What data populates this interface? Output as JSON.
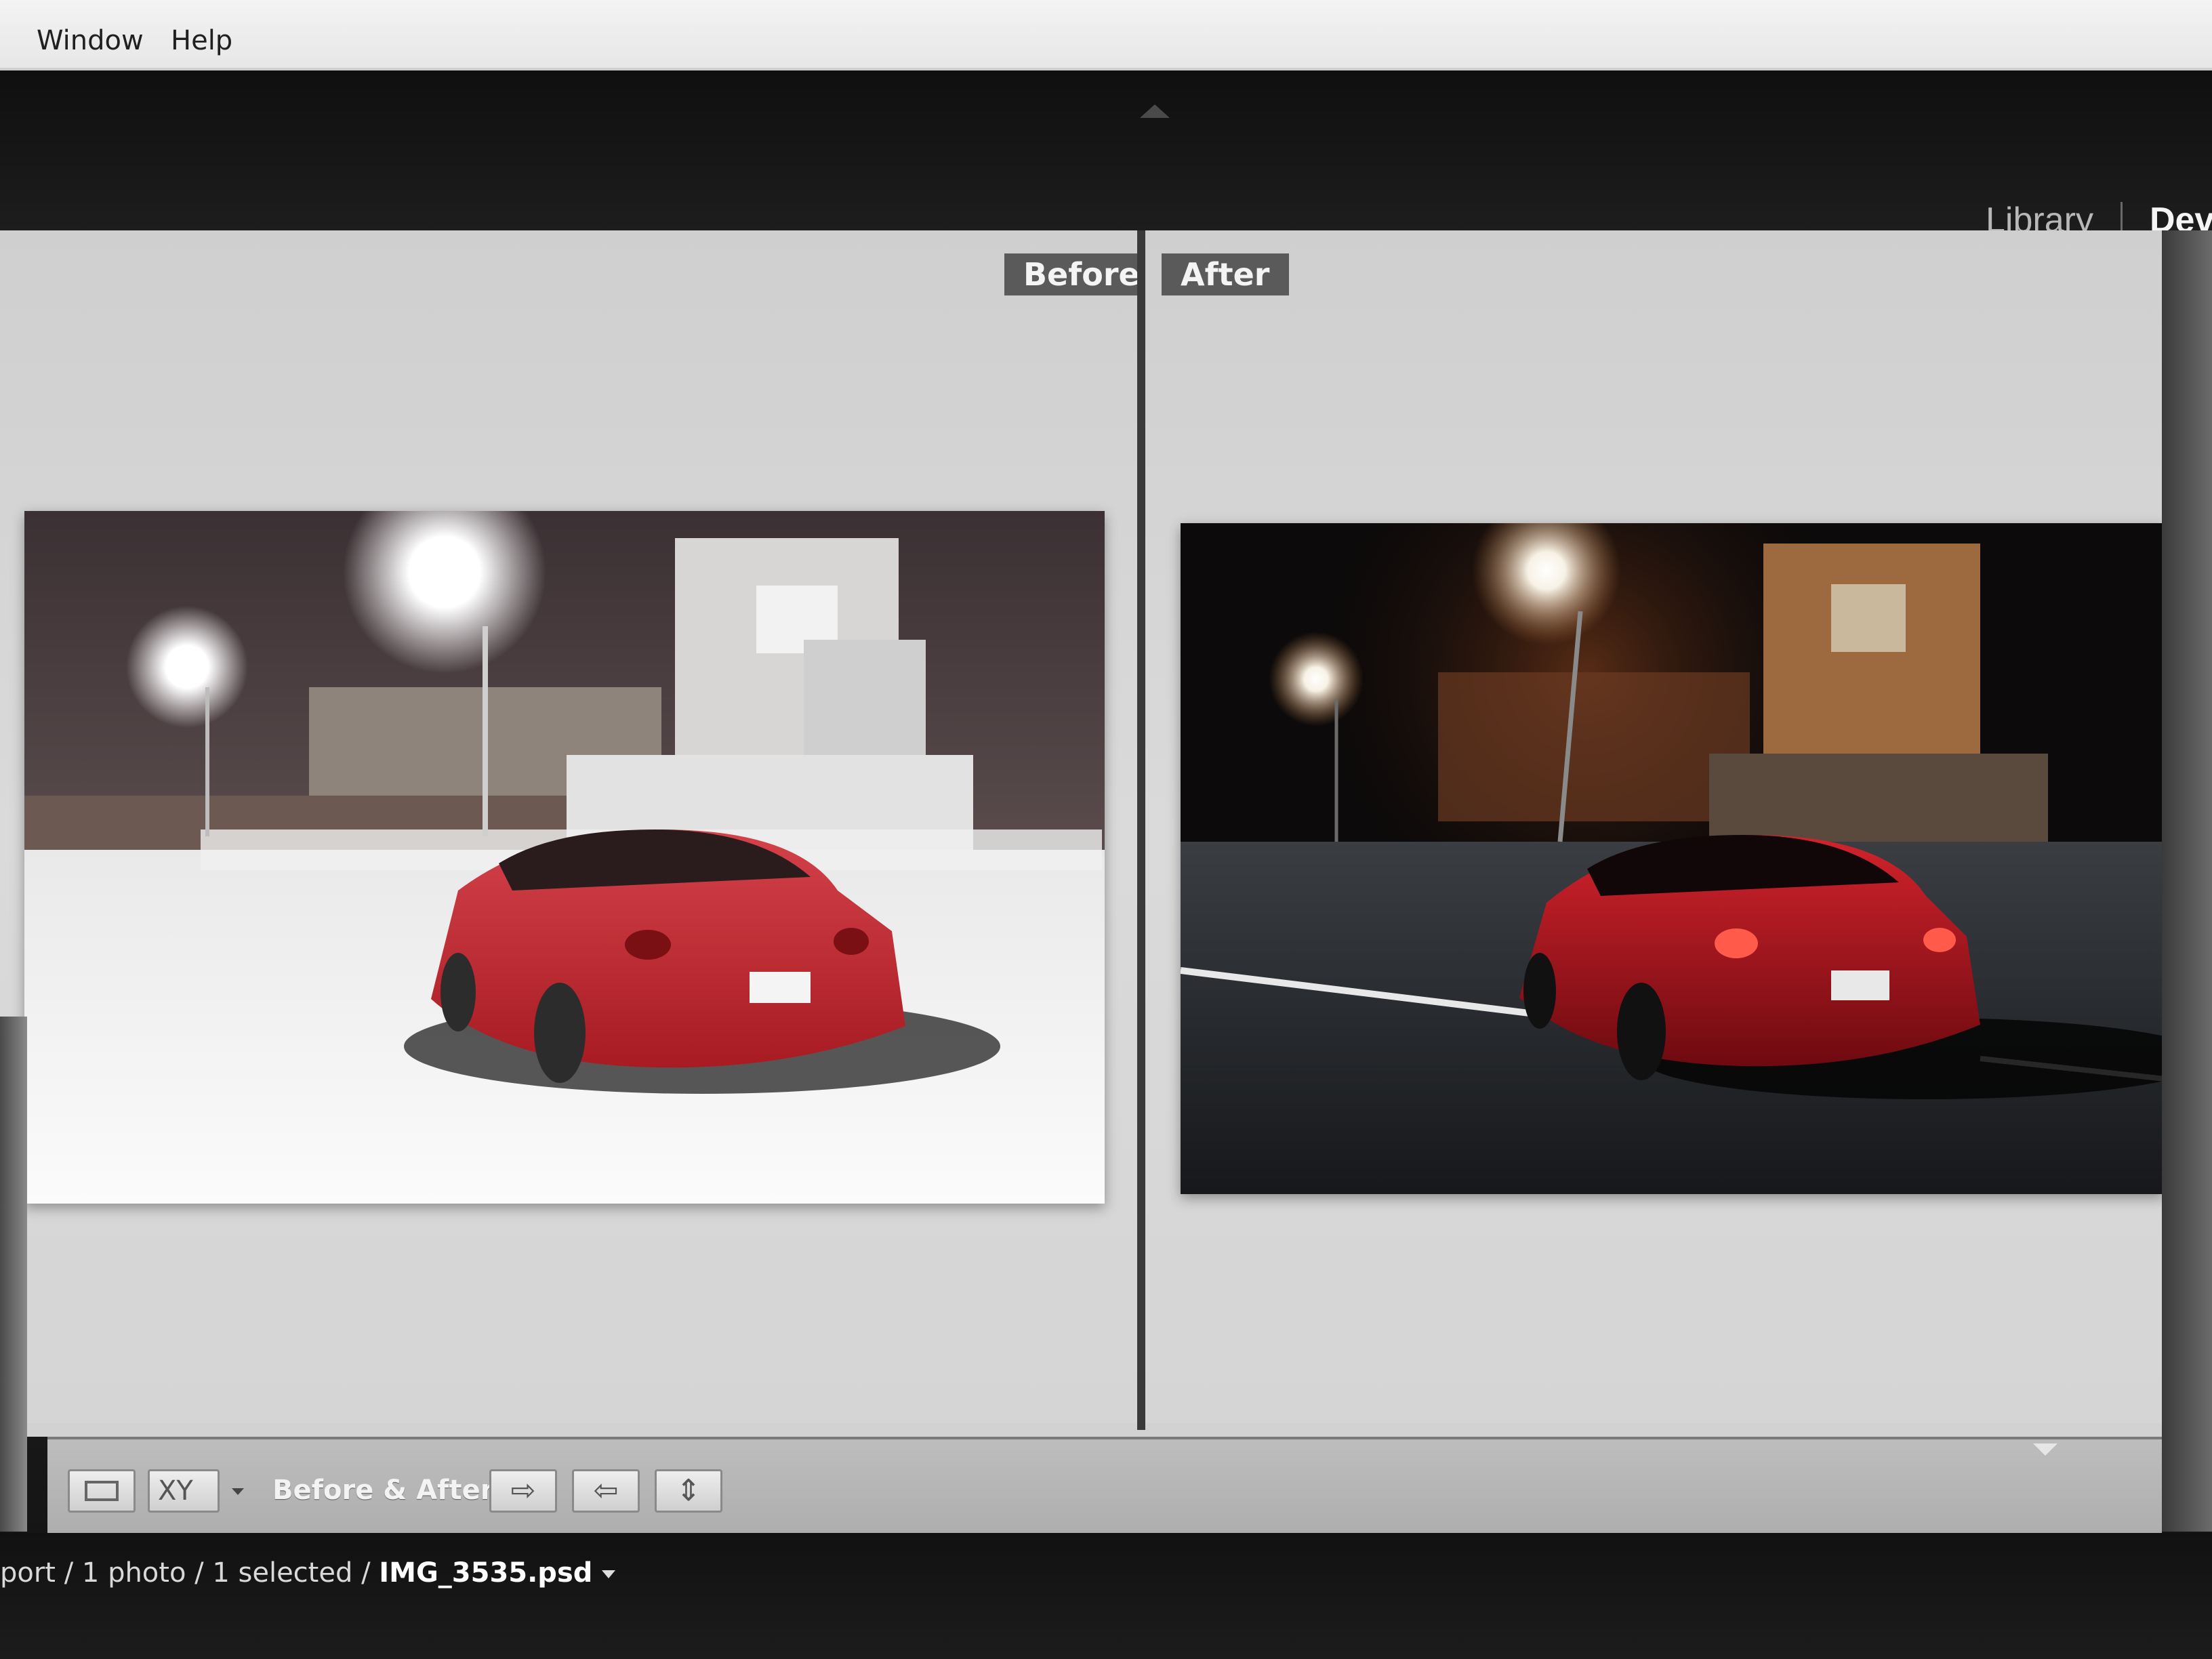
{
  "menu": {
    "items": [
      "Window",
      "Help"
    ]
  },
  "module_picker": {
    "items": [
      "Library",
      "Deve"
    ],
    "active": "Deve"
  },
  "compare": {
    "before_label": "Before",
    "after_label": "After"
  },
  "toolbar": {
    "mode_label": "Before & After :",
    "xy_glyph": "XY"
  },
  "status": {
    "path": "port / 1 photo / 1 selected / ",
    "file": "IMG_3535.psd"
  },
  "colors": {
    "car_red": "#b0141a",
    "label_bg": "#5a5a5a",
    "pane_bg": "#d2d2d2"
  }
}
